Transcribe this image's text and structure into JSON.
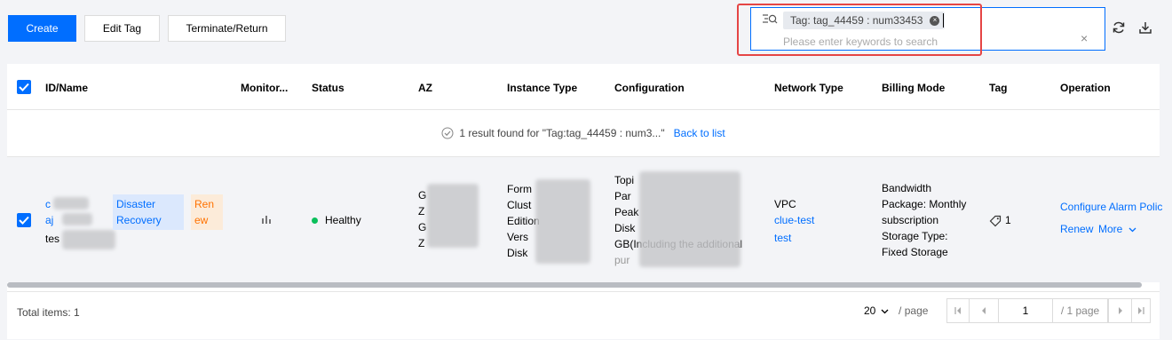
{
  "toolbar": {
    "create_label": "Create",
    "edit_tag_label": "Edit Tag",
    "terminate_label": "Terminate/Return"
  },
  "search": {
    "tag_chip": "Tag: tag_44459 : num33453",
    "placeholder": "Please enter keywords to search",
    "clear": "×",
    "chip_close": "×"
  },
  "columns": [
    "ID/Name",
    "Monitor...",
    "Status",
    "AZ",
    "Instance Type",
    "Configuration",
    "Network Type",
    "Billing Mode",
    "Tag",
    "Operation"
  ],
  "result": {
    "text": "1 result found for \"Tag:tag_44459 : num3...\"",
    "back_link": "Back to list"
  },
  "row": {
    "id_line1": "c",
    "id_line2": "aj",
    "name": "tes",
    "disaster_line1": "Disaster",
    "disaster_line2": "Recovery",
    "renew_line1": "Ren",
    "renew_line2": "ew",
    "status": "Healthy",
    "az_lines": [
      "G",
      "Z",
      "G",
      "Z"
    ],
    "instance_type_lines": [
      "Form",
      "Clust",
      "Edition",
      "Vers",
      "Disk"
    ],
    "configuration_lines": [
      "Topi",
      "Par",
      "Peak",
      "Disk",
      "GB(Including the additional",
      "pur"
    ],
    "network_type": "VPC",
    "network_link1": "clue-test",
    "network_link2": "test",
    "billing_lines": [
      "Bandwidth",
      "Package: Monthly",
      "subscription",
      "Storage Type:",
      "Fixed Storage"
    ],
    "tag_count": "1",
    "op_configure": "Configure Alarm Polic",
    "op_renew": "Renew",
    "op_more": "More"
  },
  "pager": {
    "total": "Total items: 1",
    "page_size": "20",
    "page_unit": "/ page",
    "current_page": "1",
    "total_pages": "/ 1 page"
  },
  "colors": {
    "primary": "#006eff",
    "highlight": "#e54545",
    "healthy": "#0abf5b"
  }
}
